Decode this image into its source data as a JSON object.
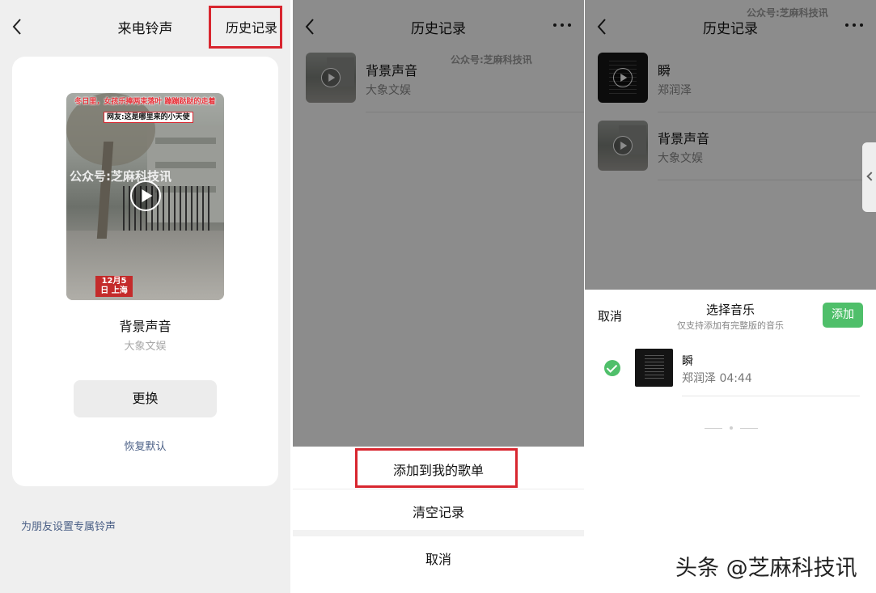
{
  "panel1": {
    "title": "来电铃声",
    "history_link": "历史记录",
    "video": {
      "caption_top": "冬日里，女孩乐捧两束落叶 蹦蹦跶跶的走着",
      "caption_sub": "网友:这是哪里来的小天使",
      "date_tag": "12月5日 上海",
      "watermark": "公众号:芝麻科技讯"
    },
    "song_title": "背景声音",
    "song_artist": "大象文娱",
    "change_button": "更换",
    "restore_link": "恢复默认",
    "friend_link": "为朋友设置专属铃声"
  },
  "panel2": {
    "title": "历史记录",
    "watermark": "公众号:芝麻科技讯",
    "items": [
      {
        "title": "背景声音",
        "artist": "大象文娱"
      }
    ],
    "sheet": {
      "add_to_playlist": "添加到我的歌单",
      "clear_history": "清空记录",
      "cancel": "取消"
    }
  },
  "panel3": {
    "title": "历史记录",
    "watermark": "公众号:芝麻科技讯",
    "items": [
      {
        "title": "瞬",
        "artist": "郑润泽"
      },
      {
        "title": "背景声音",
        "artist": "大象文娱"
      }
    ],
    "picker": {
      "cancel": "取消",
      "title": "选择音乐",
      "subtitle": "仅支持添加有完整版的音乐",
      "add_button": "添加",
      "song_title": "瞬",
      "song_meta": "郑润泽  04:44"
    }
  },
  "footer_brand": "头条 @芝麻科技讯",
  "colors": {
    "highlight_red": "#d8262f",
    "accent_green": "#4fbf6a",
    "link_blue": "#4a5f86"
  }
}
